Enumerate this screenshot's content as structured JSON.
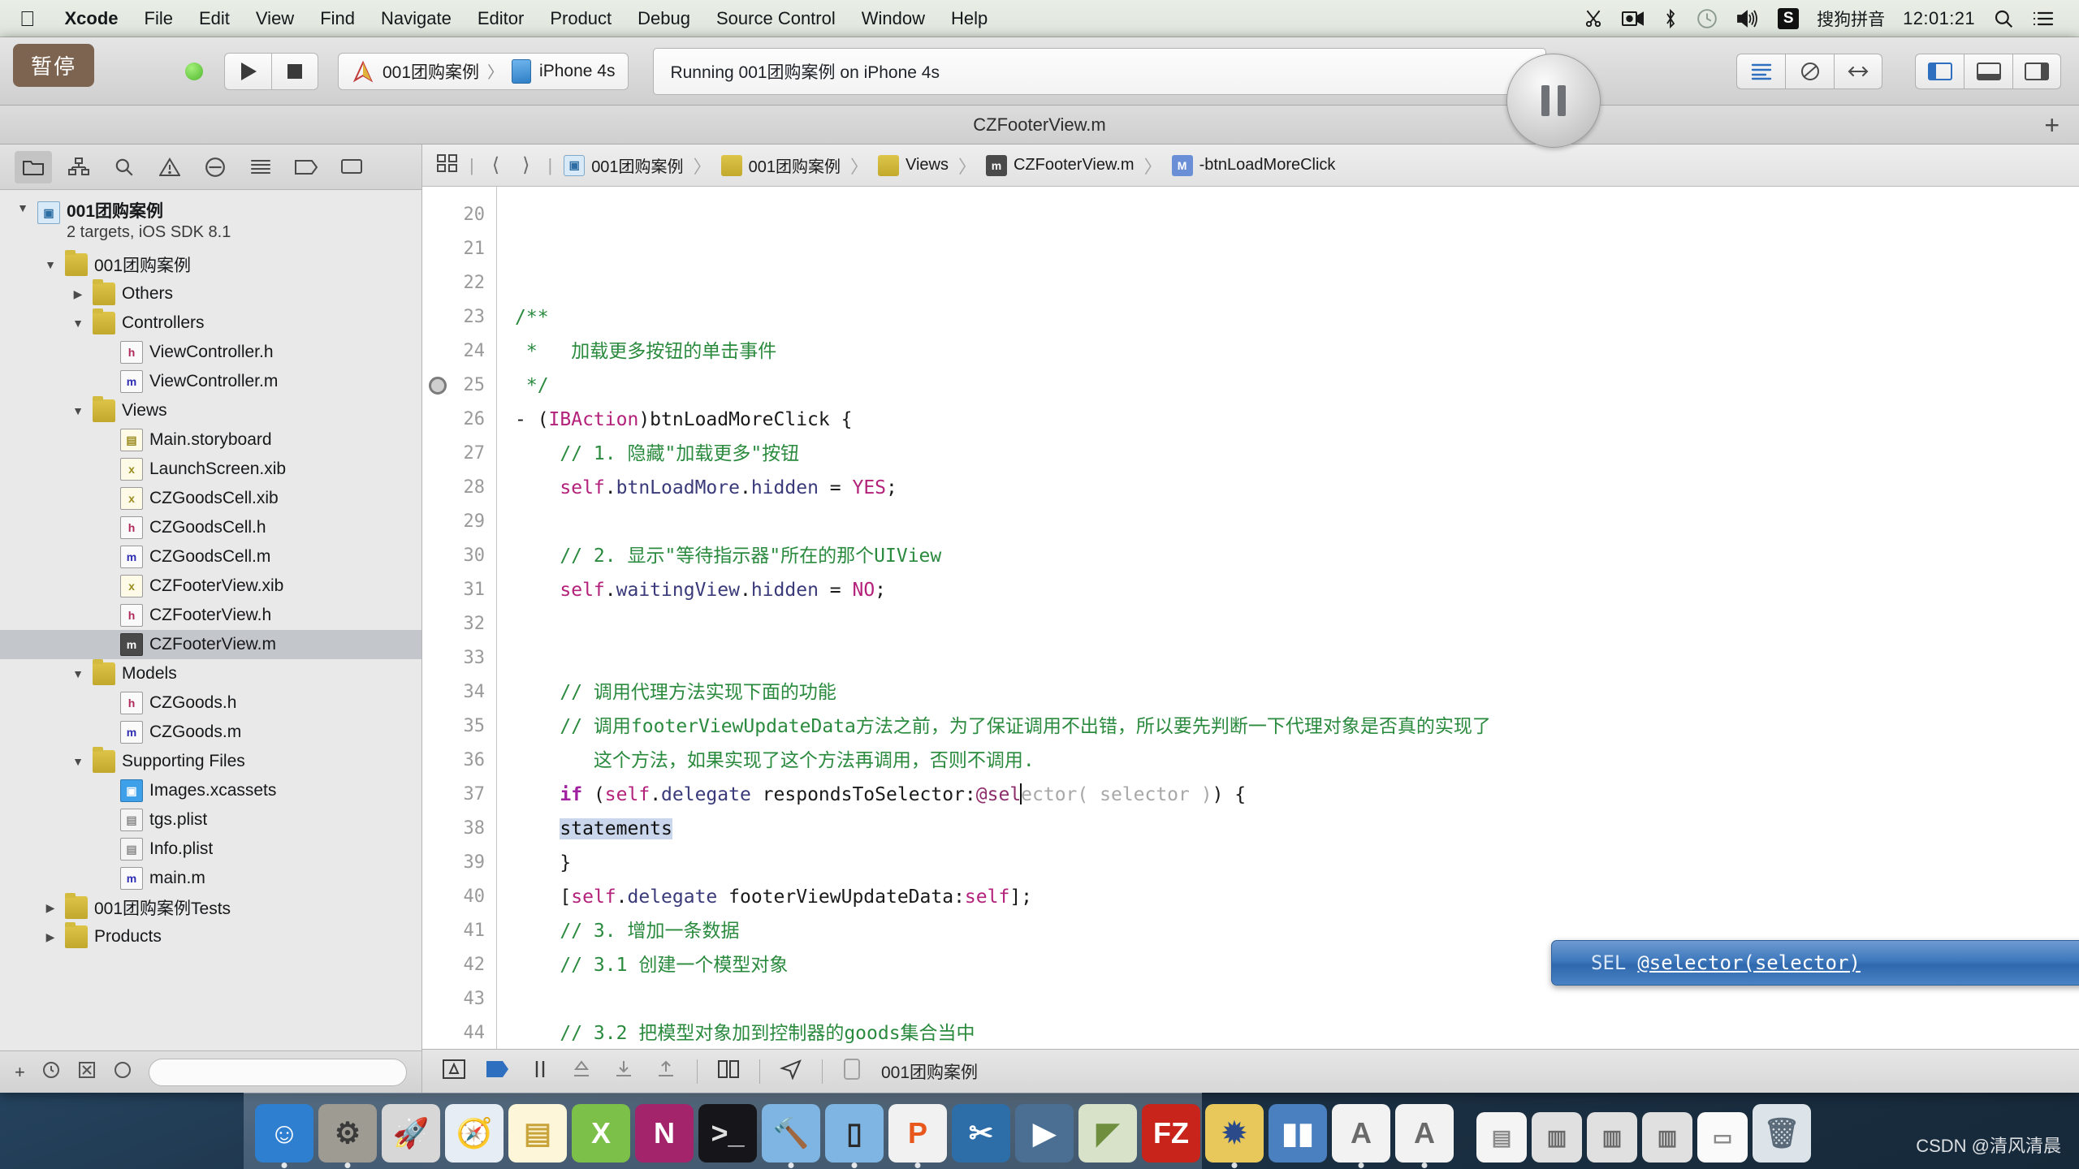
{
  "menubar": {
    "apple": "apple-logo",
    "items": [
      "Xcode",
      "File",
      "Edit",
      "View",
      "Find",
      "Navigate",
      "Editor",
      "Product",
      "Debug",
      "Source Control",
      "Window",
      "Help"
    ],
    "status": {
      "ime_badge": "S",
      "ime_label": "搜狗拼音",
      "clock": "12:01:21",
      "icons": [
        "scissors-icon",
        "screen-record-icon",
        "bluetooth-icon",
        "timemachine-icon",
        "volume-icon",
        "spotlight-search-icon",
        "notification-center-icon"
      ]
    }
  },
  "toolbar": {
    "pause_tooltip": "暂停",
    "run_label": "run-button",
    "stop_label": "stop-button",
    "scheme_project": "001团购案例",
    "scheme_sep": "〉",
    "scheme_device": "iPhone 4s",
    "status_text": "Running 001团购案例 on iPhone 4s"
  },
  "titlebar": {
    "tab_title": "CZFooterView.m",
    "plus": "+"
  },
  "navigator": {
    "tabs": [
      "project-navigator-icon",
      "symbol-navigator-icon",
      "search-navigator-icon",
      "issue-navigator-icon",
      "test-navigator-icon",
      "debug-navigator-icon",
      "breakpoint-navigator-icon",
      "report-navigator-icon"
    ],
    "tree": [
      {
        "depth": 0,
        "disc": "open",
        "icon": "proj",
        "label": "001团购案例",
        "sub": "2 targets, iOS SDK 8.1",
        "bold": true,
        "selected": false
      },
      {
        "depth": 1,
        "disc": "open",
        "icon": "folder",
        "label": "001团购案例",
        "selected": false
      },
      {
        "depth": 2,
        "disc": "closed",
        "icon": "folder",
        "label": "Others",
        "selected": false
      },
      {
        "depth": 2,
        "disc": "open",
        "icon": "folder",
        "label": "Controllers",
        "selected": false
      },
      {
        "depth": 3,
        "disc": "empty",
        "icon": "h",
        "label": "ViewController.h",
        "selected": false
      },
      {
        "depth": 3,
        "disc": "empty",
        "icon": "m",
        "label": "ViewController.m",
        "selected": false
      },
      {
        "depth": 2,
        "disc": "open",
        "icon": "folder",
        "label": "Views",
        "selected": false
      },
      {
        "depth": 3,
        "disc": "empty",
        "icon": "sb",
        "label": "Main.storyboard",
        "selected": false
      },
      {
        "depth": 3,
        "disc": "empty",
        "icon": "xib",
        "label": "LaunchScreen.xib",
        "selected": false
      },
      {
        "depth": 3,
        "disc": "empty",
        "icon": "xib",
        "label": "CZGoodsCell.xib",
        "selected": false
      },
      {
        "depth": 3,
        "disc": "empty",
        "icon": "h",
        "label": "CZGoodsCell.h",
        "selected": false
      },
      {
        "depth": 3,
        "disc": "empty",
        "icon": "m",
        "label": "CZGoodsCell.m",
        "selected": false
      },
      {
        "depth": 3,
        "disc": "empty",
        "icon": "xib",
        "label": "CZFooterView.xib",
        "selected": false
      },
      {
        "depth": 3,
        "disc": "empty",
        "icon": "h",
        "label": "CZFooterView.h",
        "selected": false
      },
      {
        "depth": 3,
        "disc": "empty",
        "icon": "m-sel",
        "label": "CZFooterView.m",
        "selected": true
      },
      {
        "depth": 2,
        "disc": "open",
        "icon": "folder",
        "label": "Models",
        "selected": false
      },
      {
        "depth": 3,
        "disc": "empty",
        "icon": "h",
        "label": "CZGoods.h",
        "selected": false
      },
      {
        "depth": 3,
        "disc": "empty",
        "icon": "m",
        "label": "CZGoods.m",
        "selected": false
      },
      {
        "depth": 2,
        "disc": "open",
        "icon": "folder",
        "label": "Supporting Files",
        "selected": false
      },
      {
        "depth": 3,
        "disc": "empty",
        "icon": "xcassets",
        "label": "Images.xcassets",
        "selected": false
      },
      {
        "depth": 3,
        "disc": "empty",
        "icon": "plist",
        "label": "tgs.plist",
        "selected": false
      },
      {
        "depth": 3,
        "disc": "empty",
        "icon": "plist",
        "label": "Info.plist",
        "selected": false
      },
      {
        "depth": 3,
        "disc": "empty",
        "icon": "m",
        "label": "main.m",
        "selected": false
      },
      {
        "depth": 1,
        "disc": "closed",
        "icon": "folder",
        "label": "001团购案例Tests",
        "selected": false
      },
      {
        "depth": 1,
        "disc": "closed",
        "icon": "folder",
        "label": "Products",
        "selected": false
      }
    ],
    "bottom": {
      "add": "+",
      "filter_placeholder": ""
    }
  },
  "jumpbar": {
    "crumbs": [
      {
        "icon": "proj",
        "label": "001团购案例"
      },
      {
        "icon": "folder",
        "label": "001团购案例"
      },
      {
        "icon": "folder",
        "label": "Views"
      },
      {
        "icon": "m",
        "label": "CZFooterView.m"
      },
      {
        "icon": "method",
        "label": "-btnLoadMoreClick"
      }
    ]
  },
  "editor": {
    "first_line": 20,
    "line_numbers": [
      20,
      21,
      22,
      23,
      24,
      25,
      26,
      27,
      28,
      29,
      30,
      31,
      32,
      33,
      34,
      "",
      35,
      36,
      37,
      38,
      39,
      40,
      41,
      42,
      43,
      44
    ],
    "breakpoint_line": 25,
    "lines": [
      "",
      "",
      "/**",
      " *   加载更多按钮的单击事件",
      " */",
      "- (IBAction)btnLoadMoreClick {",
      "    // 1. 隐藏\"加载更多\"按钮",
      "    self.btnLoadMore.hidden = YES;",
      "",
      "    // 2. 显示\"等待指示器\"所在的那个UIView",
      "    self.waitingView.hidden = NO;",
      "",
      "",
      "    // 调用代理方法实现下面的功能",
      "    // 调用footerViewUpdateData方法之前，为了保证调用不出错，所以要先判断一下代理对象是否真的实现了",
      "       这个方法，如果实现了这个方法再调用，否则不调用.",
      "    if (self.delegate respondsToSelector:@selector( selector )) {",
      "        statements",
      "    }",
      "    [self.delegate footerViewUpdateData:self];",
      "    // 3. 增加一条数据",
      "    // 3.1 创建一个模型对象",
      "",
      "    // 3.2 把模型对象加到控制器的goods集合当中",
      "",
      ""
    ],
    "autocomplete": {
      "type": "SEL",
      "name": "@selector(selector)"
    }
  },
  "debugbar": {
    "icons": [
      "show-debug-area-icon",
      "step-flag-icon",
      "pause-icon",
      "step-over-icon",
      "step-into-icon",
      "step-out-icon",
      "view-hierarchy-icon",
      "location-icon",
      "device-icon"
    ],
    "process_label": "001团购案例"
  },
  "dock": {
    "items": [
      {
        "name": "finder-icon",
        "glyph": "☺",
        "bg": "#2f7fd0",
        "fg": "#ffffff",
        "running": true
      },
      {
        "name": "system-preferences-icon",
        "glyph": "⚙",
        "bg": "#9e9b92",
        "fg": "#3a3a3a",
        "running": true
      },
      {
        "name": "launchpad-icon",
        "glyph": "🚀",
        "bg": "#d7d7d7",
        "fg": "#444444",
        "running": false
      },
      {
        "name": "safari-icon",
        "glyph": "🧭",
        "bg": "#e6edf4",
        "fg": "#2a6bb5",
        "running": false
      },
      {
        "name": "notes-icon",
        "glyph": "▤",
        "bg": "#fdf6d8",
        "fg": "#c9a43a",
        "running": false
      },
      {
        "name": "xcode-icon",
        "glyph": "X",
        "bg": "#7cc04a",
        "fg": "#ffffff",
        "running": false
      },
      {
        "name": "onenote-icon",
        "glyph": "N",
        "bg": "#a3246b",
        "fg": "#ffffff",
        "running": false
      },
      {
        "name": "terminal-icon",
        "glyph": ">_",
        "bg": "#16161a",
        "fg": "#e0e0e0",
        "running": false
      },
      {
        "name": "instruments-icon",
        "glyph": "🔨",
        "bg": "#7fb5e2",
        "fg": "#4a4a4a",
        "running": true
      },
      {
        "name": "devices-icon",
        "glyph": "▯",
        "bg": "#7fb5e2",
        "fg": "#2a2a2a",
        "running": true
      },
      {
        "name": "preview-icon",
        "glyph": "P",
        "bg": "#f1f1f1",
        "fg": "#e8571c",
        "running": true
      },
      {
        "name": "snipaste-icon",
        "glyph": "✂",
        "bg": "#2d6ea8",
        "fg": "#ffffff",
        "running": false
      },
      {
        "name": "quicktime-icon",
        "glyph": "▶",
        "bg": "#4a6f92",
        "fg": "#ffffff",
        "running": false
      },
      {
        "name": "sublime-icon",
        "glyph": "◤",
        "bg": "#d8e2c8",
        "fg": "#6f8f3f",
        "running": false
      },
      {
        "name": "filezilla-icon",
        "glyph": "FZ",
        "bg": "#c8241c",
        "fg": "#ffffff",
        "running": false
      },
      {
        "name": "utility-icon",
        "glyph": "✹",
        "bg": "#e8c85a",
        "fg": "#2a4a8a",
        "running": true
      },
      {
        "name": "chart-icon",
        "glyph": "▮▮",
        "bg": "#4a7fc0",
        "fg": "#ffffff",
        "running": false
      },
      {
        "name": "xcode-alt-icon",
        "glyph": "A",
        "bg": "#f2f2f2",
        "fg": "#6a6a6a",
        "running": true
      },
      {
        "name": "xcode-alt2-icon",
        "glyph": "A",
        "bg": "#f2f2f2",
        "fg": "#6a6a6a",
        "running": true
      }
    ],
    "minimized": [
      {
        "name": "minimized-window-doc",
        "glyph": "▤",
        "bg": "#f4f4f4",
        "fg": "#8a8a8a"
      },
      {
        "name": "minimized-window-1",
        "glyph": "▥",
        "bg": "#e0e0e0",
        "fg": "#6a6a6a"
      },
      {
        "name": "minimized-window-2",
        "glyph": "▥",
        "bg": "#e0e0e0",
        "fg": "#6a6a6a"
      },
      {
        "name": "minimized-window-3",
        "glyph": "▥",
        "bg": "#e0e0e0",
        "fg": "#6a6a6a"
      },
      {
        "name": "minimized-window-4",
        "glyph": "▭",
        "bg": "#fafafa",
        "fg": "#8a8a8a"
      }
    ],
    "trash": {
      "name": "trash-icon",
      "glyph": "🗑",
      "bg": "#dce4ea",
      "fg": "#5a6a78"
    }
  },
  "watermark": "CSDN @清风清晨",
  "colors": {
    "accent_blue": "#3f79bd",
    "comment_green": "#2a8a3e",
    "keyword_purple": "#a020a0",
    "tooltip_brown": "#7d6450",
    "selection_gray": "#c3c7cc"
  }
}
